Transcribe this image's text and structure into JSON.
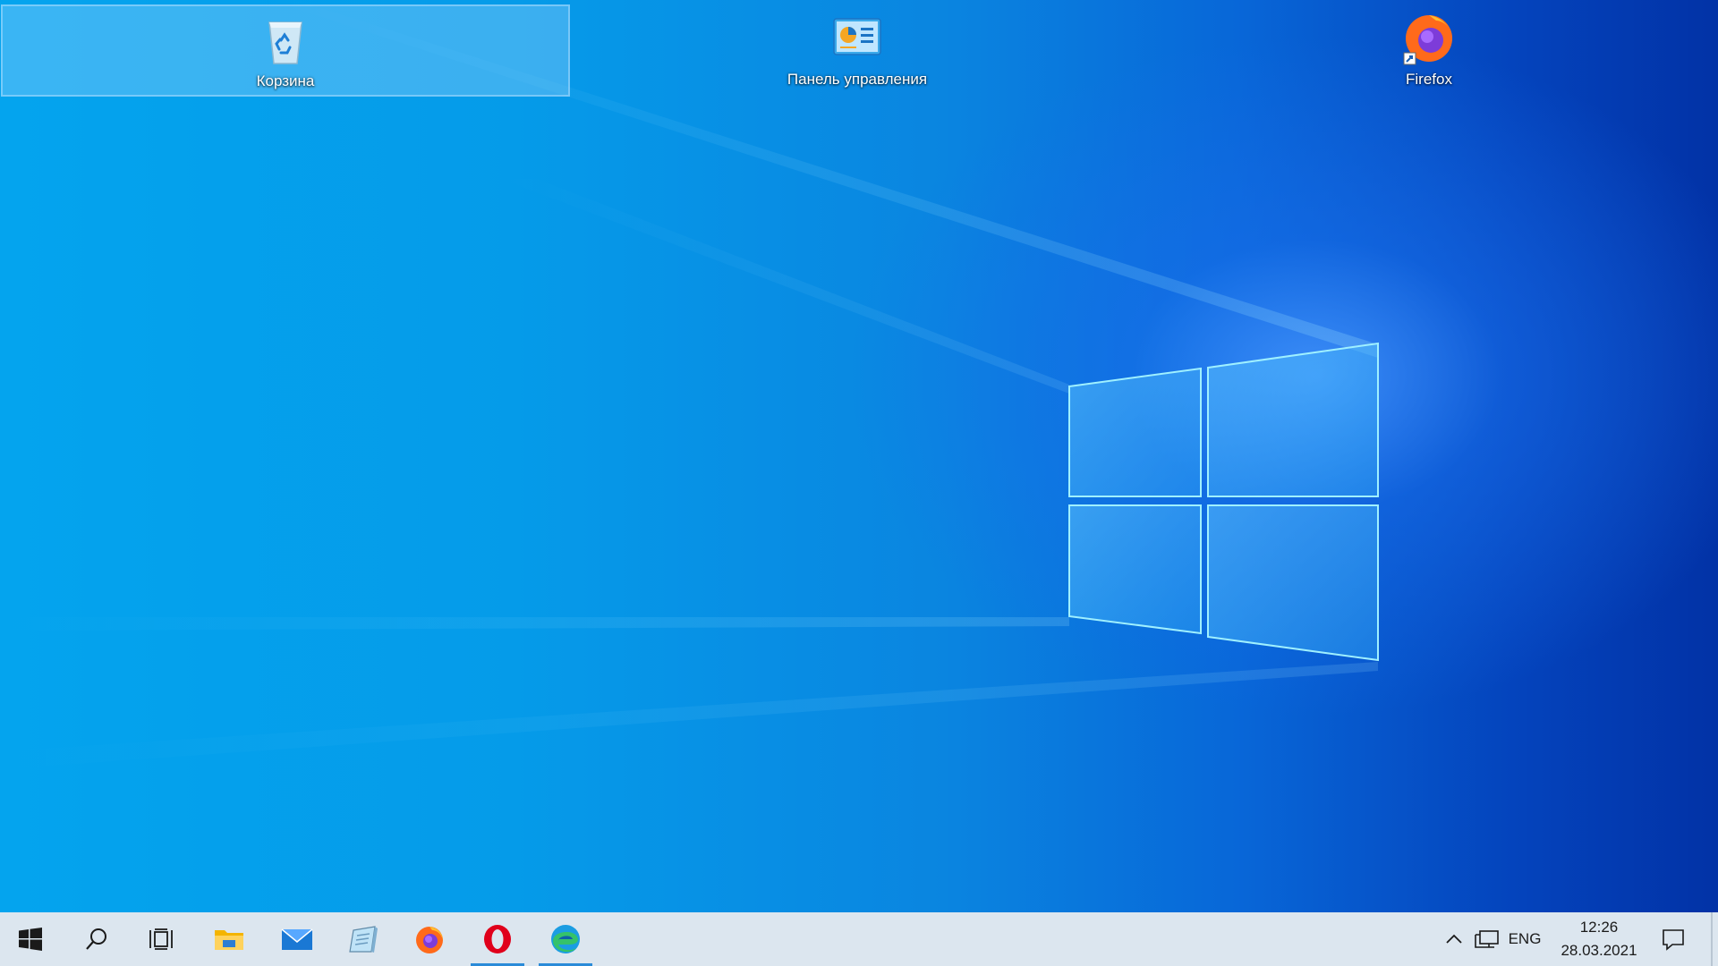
{
  "desktop": {
    "icons": [
      {
        "label": "Корзина",
        "icon": "recycle-bin-icon",
        "selected": true
      },
      {
        "label": "Панель управления",
        "icon": "control-panel-icon",
        "selected": false
      },
      {
        "label": "Firefox",
        "icon": "firefox-icon",
        "selected": false,
        "shortcut": true
      }
    ]
  },
  "taskbar": {
    "pinned": [
      {
        "name": "start",
        "icon": "windows-logo-icon"
      },
      {
        "name": "search",
        "icon": "search-icon"
      },
      {
        "name": "task-view",
        "icon": "task-view-icon"
      },
      {
        "name": "file-explorer",
        "icon": "folder-icon"
      },
      {
        "name": "mail",
        "icon": "mail-icon"
      },
      {
        "name": "notepad",
        "icon": "notepad-icon"
      },
      {
        "name": "firefox",
        "icon": "firefox-icon"
      },
      {
        "name": "opera",
        "icon": "opera-icon",
        "running": true
      },
      {
        "name": "edge",
        "icon": "edge-icon",
        "running": true
      }
    ],
    "tray": {
      "language": "ENG",
      "time": "12:26",
      "date": "28.03.2021"
    }
  },
  "colors": {
    "accent": "#0078d7",
    "taskbar_bg": "#dce6ef",
    "running_indicator": "#2a8bd8"
  }
}
